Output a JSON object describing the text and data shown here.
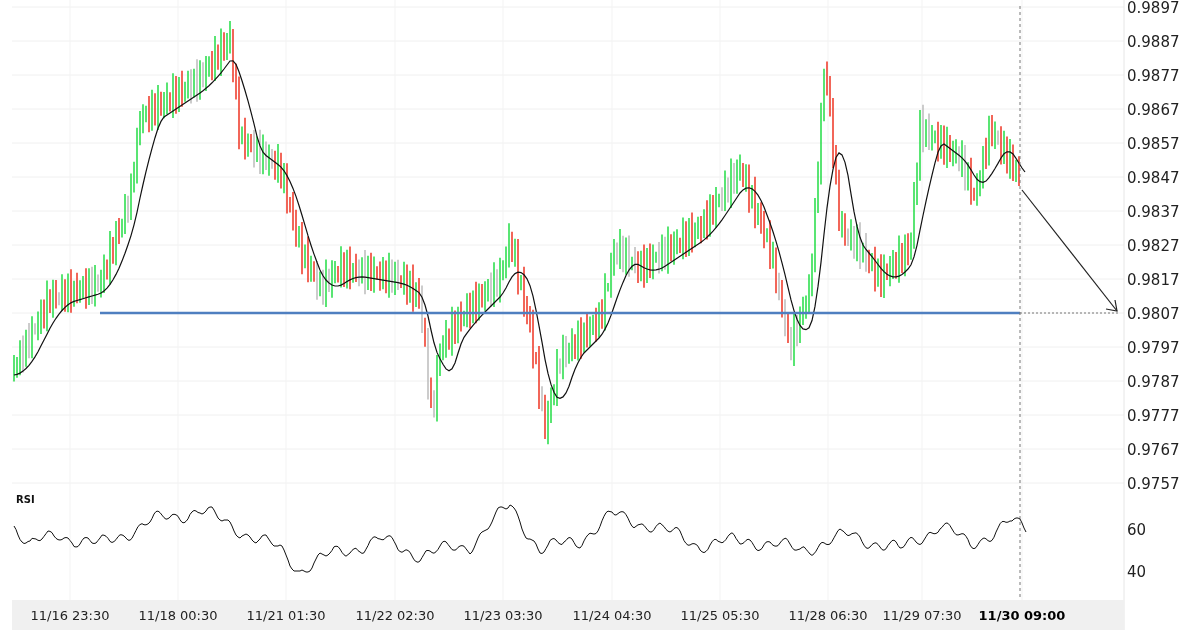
{
  "price_axis": {
    "ticks": [
      "0.9897",
      "0.9887",
      "0.9877",
      "0.9867",
      "0.9857",
      "0.9847",
      "0.9837",
      "0.9827",
      "0.9817",
      "0.9807",
      "0.9797",
      "0.9787",
      "0.9777",
      "0.9767",
      "0.9757"
    ]
  },
  "rsi_panel": {
    "title": "RSI",
    "ticks": [
      "60",
      "40"
    ]
  },
  "time_axis": {
    "labels": [
      {
        "text": "11/16 23:30",
        "current": false
      },
      {
        "text": "11/18 00:30",
        "current": false
      },
      {
        "text": "11/21 01:30",
        "current": false
      },
      {
        "text": "11/22 02:30",
        "current": false
      },
      {
        "text": "11/23 03:30",
        "current": false
      },
      {
        "text": "11/24 04:30",
        "current": false
      },
      {
        "text": "11/25 05:30",
        "current": false
      },
      {
        "text": "11/28 06:30",
        "current": false
      },
      {
        "text": "11/29 07:30",
        "current": false
      },
      {
        "text": "11/30 09:00",
        "current": true
      }
    ]
  }
}
